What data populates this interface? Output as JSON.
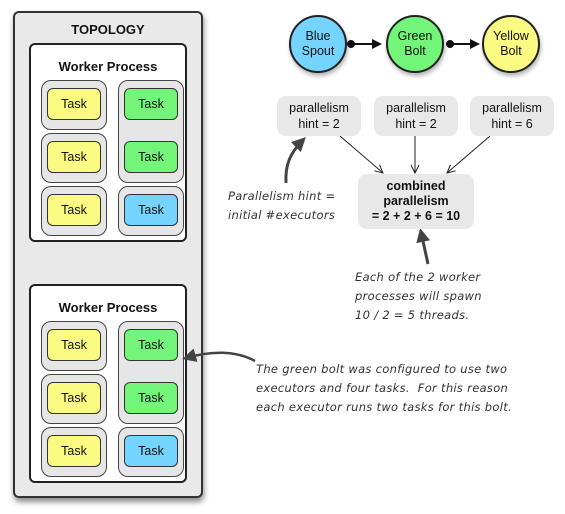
{
  "topology": {
    "title": "TOPOLOGY",
    "workers": [
      {
        "title": "Worker Process",
        "executors_left": [
          {
            "tasks": [
              {
                "label": "Task",
                "color": "yellow"
              }
            ]
          },
          {
            "tasks": [
              {
                "label": "Task",
                "color": "yellow"
              }
            ]
          },
          {
            "tasks": [
              {
                "label": "Task",
                "color": "yellow"
              }
            ]
          }
        ],
        "executors_right": [
          {
            "tasks": [
              {
                "label": "Task",
                "color": "green"
              },
              {
                "label": "Task",
                "color": "green"
              }
            ]
          },
          {
            "tasks": [
              {
                "label": "Task",
                "color": "blue"
              }
            ]
          }
        ]
      },
      {
        "title": "Worker Process",
        "executors_left": [
          {
            "tasks": [
              {
                "label": "Task",
                "color": "yellow"
              }
            ]
          },
          {
            "tasks": [
              {
                "label": "Task",
                "color": "yellow"
              }
            ]
          },
          {
            "tasks": [
              {
                "label": "Task",
                "color": "yellow"
              }
            ]
          }
        ],
        "executors_right": [
          {
            "tasks": [
              {
                "label": "Task",
                "color": "green"
              },
              {
                "label": "Task",
                "color": "green"
              }
            ]
          },
          {
            "tasks": [
              {
                "label": "Task",
                "color": "blue"
              }
            ]
          }
        ]
      }
    ]
  },
  "graph": {
    "nodes": [
      {
        "line1": "Blue",
        "line2": "Spout",
        "color": "#74d4fd"
      },
      {
        "line1": "Green",
        "line2": "Bolt",
        "color": "#72f578"
      },
      {
        "line1": "Yellow",
        "line2": "Bolt",
        "color": "#fbfb83"
      }
    ],
    "hints": [
      {
        "line1": "parallelism",
        "line2": "hint = 2"
      },
      {
        "line1": "parallelism",
        "line2": "hint = 2"
      },
      {
        "line1": "parallelism",
        "line2": "hint = 6"
      }
    ],
    "combined": {
      "line1": "combined",
      "line2": "parallelism",
      "line3": "= 2 + 2 + 6 = 10"
    }
  },
  "notes": {
    "hint_note": "Parallelism hint =\ninitial #executors",
    "threads_note": "Each of the 2 worker\nprocesses will spawn\n10 / 2 = 5 threads.",
    "green_bolt_note": "The green bolt was configured to use two\nexecutors and four tasks.  For this reason\neach executor runs two tasks for this bolt."
  },
  "colors": {
    "yellow": "#fbfb83",
    "green": "#72f578",
    "blue": "#74d4fd",
    "box_gray": "#e8e8e8"
  }
}
